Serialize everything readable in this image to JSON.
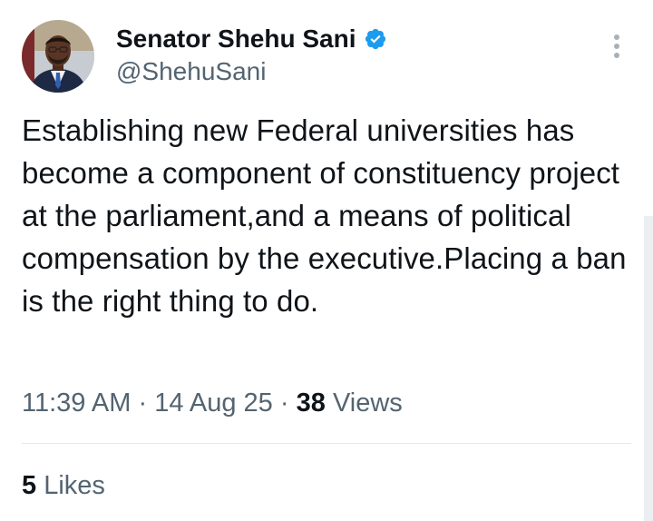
{
  "author": {
    "display_name": "Senator Shehu Sani",
    "handle": "@ShehuSani",
    "verified": true,
    "avatar_icon": "profile-photo"
  },
  "tweet": {
    "text": "Establishing new Federal universities has become a component of constituency project at the parliament,and a means of political compensation by the executive.Placing a ban is the right thing to do."
  },
  "meta": {
    "time": "11:39 AM",
    "date": "14 Aug 25",
    "separator": "·",
    "views_count": "38",
    "views_label": "Views"
  },
  "engagement": {
    "likes_count": "5",
    "likes_label": "Likes"
  },
  "colors": {
    "text_primary": "#0f1419",
    "text_secondary": "#536471",
    "verified_blue": "#1d9bf0",
    "divider": "#e4e8eb"
  },
  "icons": {
    "verified": "verified-badge-icon",
    "more": "more-options-icon"
  }
}
